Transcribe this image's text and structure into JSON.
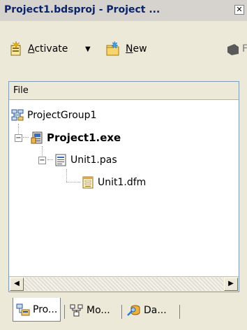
{
  "window": {
    "title": "Project1.bdsproj - Project ...",
    "close_glyph": "✕"
  },
  "toolbar": {
    "activate_label": "Activate",
    "activate_underline": "A",
    "activate_rest": "ctivate",
    "dropdown_glyph": "▼",
    "new_underline": "N",
    "new_rest": "ew",
    "partial_label": "F"
  },
  "panel": {
    "header": "File",
    "tree": [
      {
        "label": "ProjectGroup1",
        "icon": "project-group-icon",
        "bold": false
      },
      {
        "label": "Project1.exe",
        "icon": "project-exe-icon",
        "bold": true,
        "expander": "−"
      },
      {
        "label": "Unit1.pas",
        "icon": "pascal-unit-icon",
        "bold": false,
        "expander": "−"
      },
      {
        "label": "Unit1.dfm",
        "icon": "form-file-icon",
        "bold": false
      }
    ],
    "scroll_left": "◀",
    "scroll_right": "▶"
  },
  "tabs": [
    {
      "label": "Pro...",
      "icon": "project-manager-icon",
      "active": true
    },
    {
      "label": "Mo...",
      "icon": "model-view-icon",
      "active": false
    },
    {
      "label": "Da...",
      "icon": "data-explorer-icon",
      "active": false
    }
  ],
  "colors": {
    "title_text": "#0a246a",
    "face": "#ece9d8",
    "panel_border": "#7f9db9"
  }
}
